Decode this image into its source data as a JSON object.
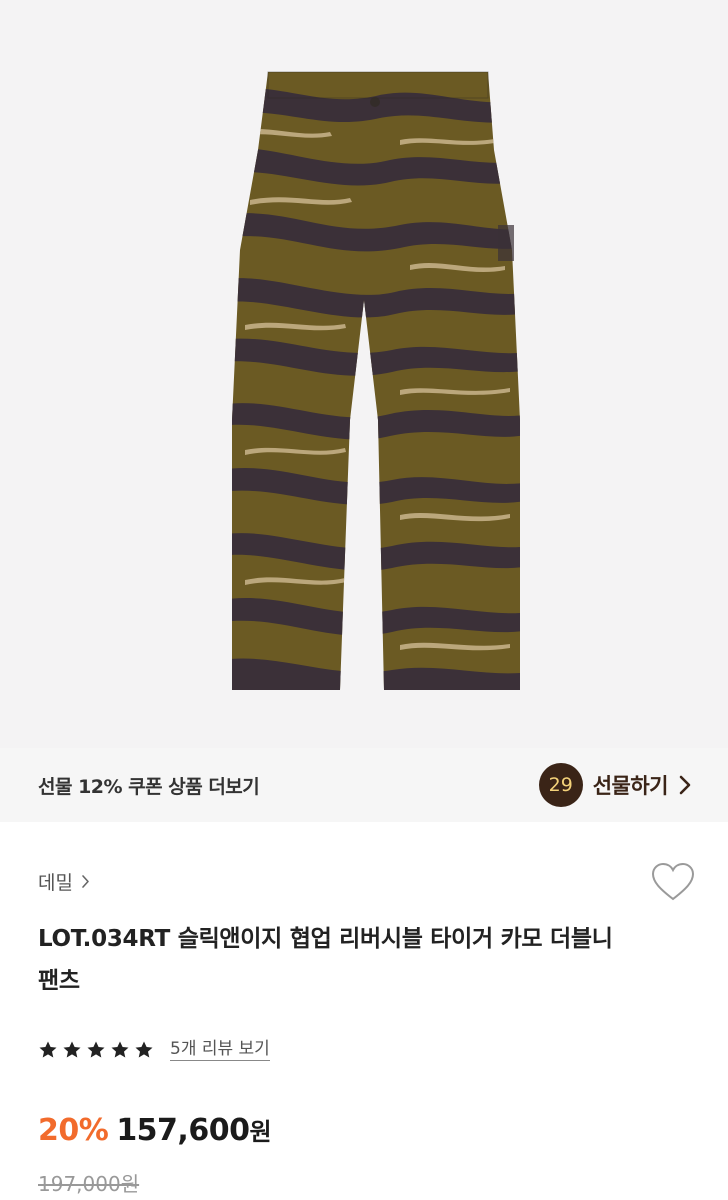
{
  "product_image": {
    "icon": "camo-double-knee-pants-image",
    "colors": {
      "background": "#f4f3f4",
      "olive": "#6b5a23",
      "dark_stripe": "#3b3038",
      "light_stripe": "#c9b58c"
    }
  },
  "gift_bar": {
    "text": "선물 12% 쿠폰 상품 더보기",
    "count": "29",
    "action_label": "선물하기"
  },
  "product": {
    "brand": "데밀",
    "title": "LOT.034RT 슬릭앤이지 협업 리버시블 타이거 카모 더블니 팬츠",
    "rating_stars": 5,
    "review_link": "5개 리뷰 보기",
    "discount": "20%",
    "price": "157,600",
    "price_unit": "원",
    "original_price": "197,000원"
  },
  "colors": {
    "accent_discount": "#f26b2c",
    "gift_badge_bg": "#3a2417",
    "gift_badge_text": "#f4d27a"
  }
}
